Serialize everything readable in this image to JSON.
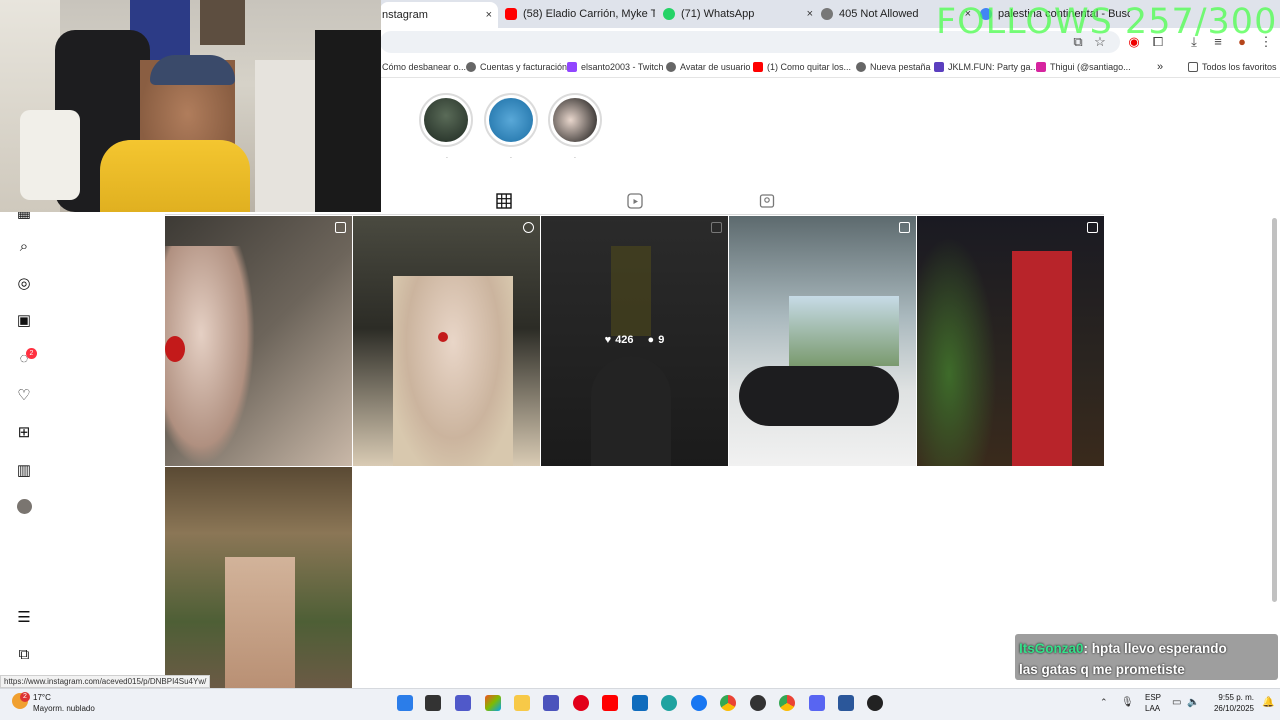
{
  "browser": {
    "tabs": [
      {
        "id": "active",
        "title": "nstagram",
        "close": "×"
      },
      {
        "id": "2",
        "title": "(58) Eladio Carrión, Myke Towe",
        "close": "×"
      },
      {
        "id": "3",
        "title": "(71) WhatsApp",
        "close": "×"
      },
      {
        "id": "4",
        "title": "405 Not Allowed",
        "close": "×"
      },
      {
        "id": "5",
        "title": "palestina continental - Busca",
        "close": "×"
      }
    ],
    "bookmarks": [
      "Cómo desbanear o...",
      "Cuentas y facturación",
      "elsanto2003 - Twitch",
      "Avatar de usuario",
      "(1) Como quitar los...",
      "Nueva pestaña",
      "JKLM.FUN: Party ga...",
      "Thigui (@santiago...",
      "»",
      "Todos los favoritos"
    ]
  },
  "stream_overlay": {
    "follows": "FOLLOWS 257/300",
    "chat_user": "ItsGonza0",
    "chat_message_1": ": hpta llevo esperando",
    "chat_message_2": "las gatas q me prometiste"
  },
  "instagram": {
    "posts": [
      {
        "id": "1",
        "likes": "",
        "comments": ""
      },
      {
        "id": "2",
        "likes": "",
        "comments": ""
      },
      {
        "id": "3",
        "likes": "426",
        "comments": "9"
      },
      {
        "id": "4",
        "likes": "",
        "comments": ""
      },
      {
        "id": "5",
        "likes": "",
        "comments": ""
      },
      {
        "id": "6",
        "likes": "",
        "comments": ""
      }
    ],
    "notification_count": "2"
  },
  "status_url": "https://www.instagram.com/aceved015/p/DNBPI4Su4Yw/",
  "taskbar": {
    "weather_temp": "17°C",
    "weather_desc": "Mayorm. nublado",
    "weather_badge": "2",
    "lang_1": "ESP",
    "lang_2": "LAA",
    "time": "9:55 p. m.",
    "date": "26/10/2025"
  },
  "icons": {
    "nav": [
      "grid-icon",
      "search-icon",
      "explore-icon",
      "reels-icon",
      "messages-icon",
      "heart-icon",
      "create-icon",
      "dashboard-icon",
      "avatar",
      "menu-icon",
      "threads-icon"
    ]
  }
}
